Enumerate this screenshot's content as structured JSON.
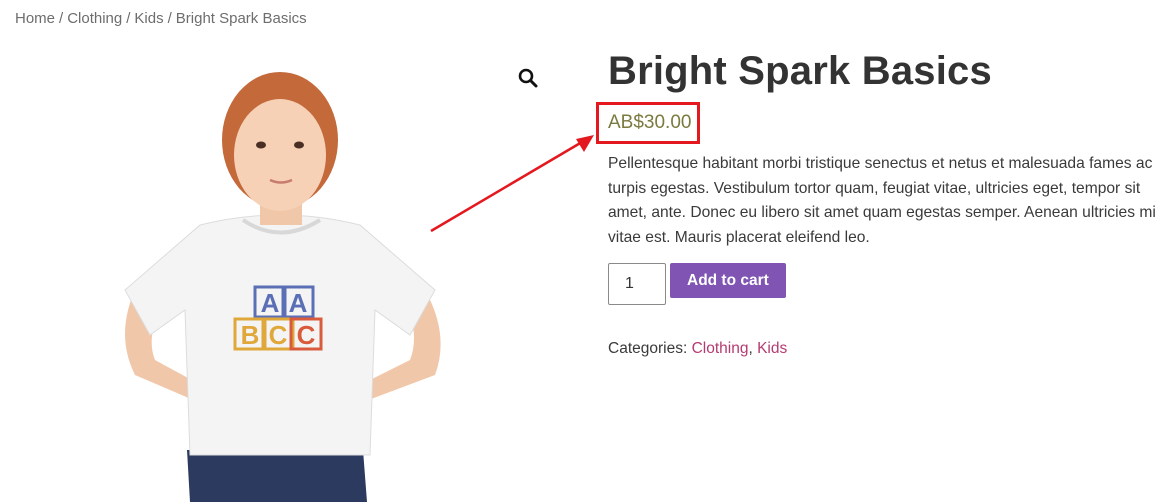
{
  "breadcrumb": {
    "home": "Home",
    "clothing": "Clothing",
    "kids": "Kids",
    "current": "Bright Spark Basics",
    "separator": "/"
  },
  "product": {
    "title": "Bright Spark Basics",
    "price": "AB$30.00",
    "description": "Pellentesque habitant morbi tristique senectus et netus et malesuada fames ac turpis egestas. Vestibulum tortor quam, feugiat vitae, ultricies eget, tempor sit amet, ante. Donec eu libero sit amet quam egestas semper. Aenean ultricies mi vitae est. Mauris placerat eleifend leo.",
    "quantity": "1",
    "add_to_cart": "Add to cart",
    "categories_label": "Categories:",
    "categories": [
      "Clothing",
      "Kids"
    ],
    "category_separator": ","
  },
  "shirt_print": {
    "blocks": [
      "A",
      "A",
      "B",
      "C",
      "C"
    ]
  },
  "colors": {
    "accent_button": "#7f54b3",
    "price": "#7b7a3f",
    "link": "#b43b71",
    "annotation": "#e3191f"
  },
  "icons": {
    "zoom": "magnifier-icon"
  }
}
